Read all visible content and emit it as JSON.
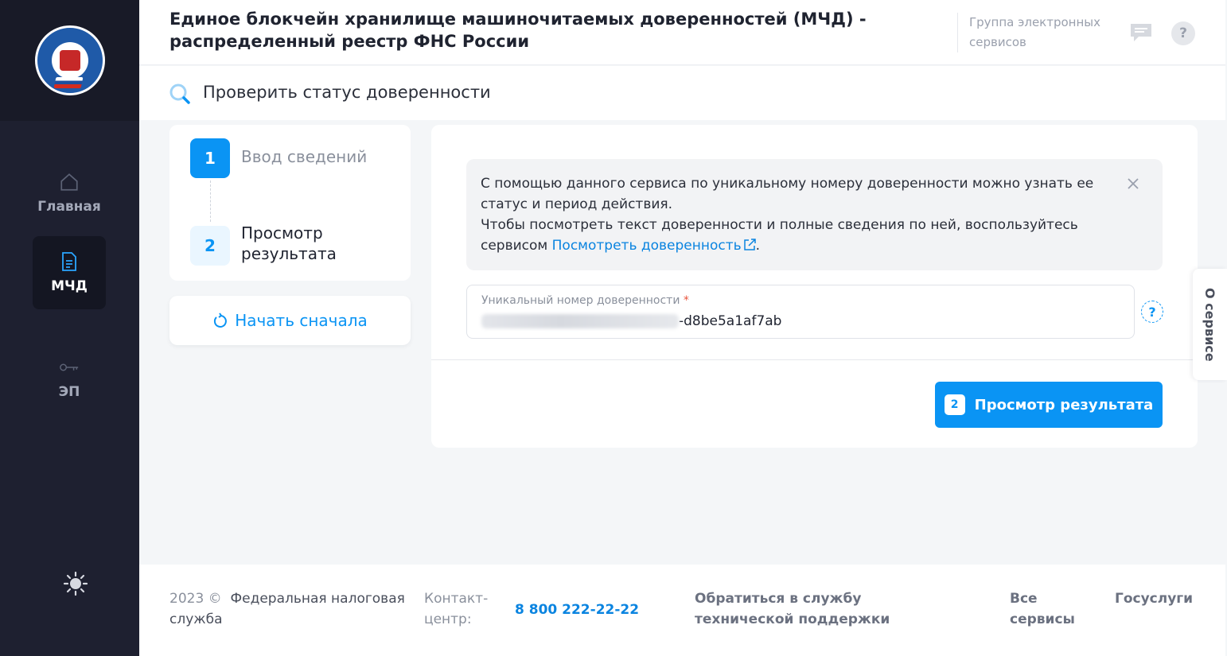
{
  "colors": {
    "accent": "#0a94f4",
    "sidebar_bg": "#1e2030",
    "link": "#0a84e0"
  },
  "sidebar": {
    "logo_icon": "fns-emblem-icon",
    "items": [
      {
        "label": "Главная",
        "icon": "home-icon",
        "active": false
      },
      {
        "label": "МЧД",
        "icon": "document-icon",
        "active": true
      },
      {
        "label": "ЭП",
        "icon": "key-icon",
        "active": false
      }
    ],
    "theme_icon": "sun-icon"
  },
  "header": {
    "title": "Единое блокчейн хранилище машиночитаемых доверенностей (МЧД) - распределенный реестр ФНС России",
    "group_link": "Группа электронных сервисов",
    "chat_icon": "chat-icon",
    "help_label": "?"
  },
  "subheader": {
    "title": "Проверить статус доверенности",
    "icon": "search-icon"
  },
  "steps": [
    {
      "num": "1",
      "label": "Ввод сведений",
      "current": true
    },
    {
      "num": "2",
      "label": "Просмотр результата",
      "current": false
    }
  ],
  "restart_label": "Начать сначала",
  "info": {
    "text1": "С помощью данного сервиса по уникальному номеру доверенности можно узнать ее статус и период действия.",
    "text2_prefix": "Чтобы посмотреть текст доверенности и полные сведения по ней, воспользуйтесь сервисом ",
    "link": "Посмотреть доверенность",
    "text2_suffix": "."
  },
  "field": {
    "label": "Уникальный номер доверенности",
    "required_mark": "*",
    "value_visible": "-d8be5a1af7ab",
    "help_label": "?"
  },
  "submit": {
    "badge": "2",
    "label": "Просмотр результата"
  },
  "side_tab": {
    "label": "О сервисе"
  },
  "footer": {
    "year": "2023 ©",
    "org": "Федеральная налоговая служба",
    "contact_label": "Контакт-центр:",
    "phone": "8 800 222-22-22",
    "support": "Обратиться в службу технической поддержки",
    "all_services": "Все сервисы",
    "gosuslugi": "Госуслуги"
  }
}
